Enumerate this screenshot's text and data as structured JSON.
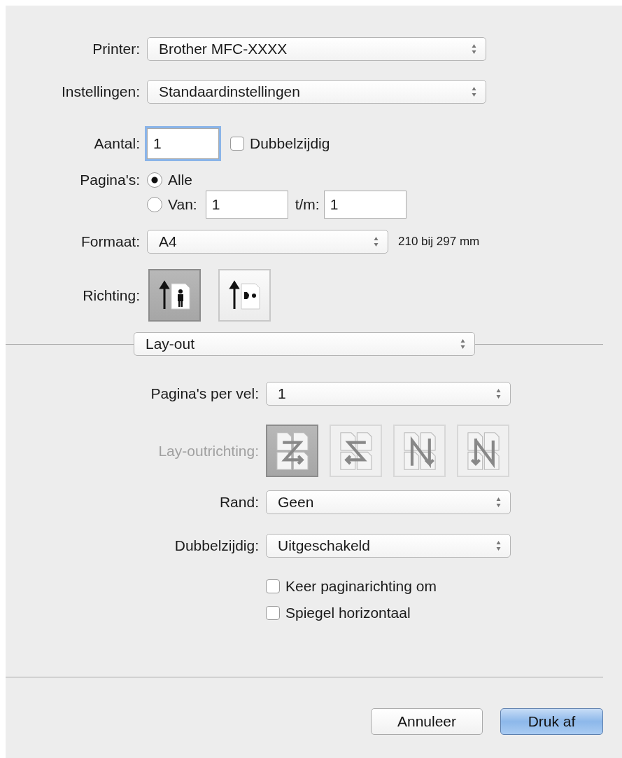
{
  "printer": {
    "label": "Printer:",
    "value": "Brother MFC-XXXX"
  },
  "presets": {
    "label": "Instellingen:",
    "value": "Standaardinstellingen"
  },
  "copies": {
    "label": "Aantal:",
    "value": "1"
  },
  "duplex": {
    "label": "Dubbelzijdig",
    "checked": false
  },
  "pages": {
    "label": "Pagina's:",
    "options": [
      {
        "kind": "all",
        "label": "Alle",
        "selected": true
      },
      {
        "kind": "range",
        "label": "Van:",
        "from": "1",
        "to_label": "t/m:",
        "to": "1",
        "selected": false
      }
    ]
  },
  "paper_size": {
    "label": "Formaat:",
    "value": "A4",
    "dimensions": "210 bij 297 mm"
  },
  "orientation": {
    "label": "Richting:",
    "options": [
      {
        "kind": "portrait",
        "selected": true
      },
      {
        "kind": "landscape",
        "selected": false
      }
    ]
  },
  "section": {
    "value": "Lay-out"
  },
  "pages_per_sheet": {
    "label": "Pagina's per vel:",
    "value": "1"
  },
  "layout_direction": {
    "label": "Lay-outrichting:",
    "disabled": true,
    "options": [
      {
        "kind": "z",
        "selected": true
      },
      {
        "kind": "s",
        "selected": false
      },
      {
        "kind": "n-reverse",
        "selected": false
      },
      {
        "kind": "n",
        "selected": false
      }
    ]
  },
  "border": {
    "label": "Rand:",
    "value": "Geen"
  },
  "two_sided": {
    "label": "Dubbelzijdig:",
    "value": "Uitgeschakeld"
  },
  "options": [
    {
      "label": "Keer paginarichting om",
      "checked": false
    },
    {
      "label": "Spiegel horizontaal",
      "checked": false
    }
  ],
  "buttons": [
    {
      "label": "Annuleer",
      "kind": "cancel"
    },
    {
      "label": "Druk af",
      "kind": "default"
    }
  ]
}
